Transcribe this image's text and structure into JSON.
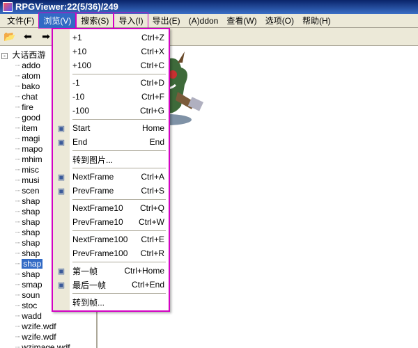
{
  "window": {
    "title": "RPGViewer:22(5/36)/249"
  },
  "menubar": {
    "file": "文件(F)",
    "browse": "浏览(V)",
    "search": "搜索(S)",
    "import": "导入(I)",
    "export": "导出(E)",
    "addon": "(A)ddon",
    "view": "查看(W)",
    "options": "选项(O)",
    "help": "帮助(H)"
  },
  "tree": {
    "root": "大话西游",
    "items": [
      "addo",
      "atom",
      "bako",
      "chat",
      "fire",
      "good",
      "item",
      "magi",
      "mapo",
      "mhim",
      "misc",
      "musi",
      "scen",
      "shap",
      "shap",
      "shap",
      "shap",
      "shap",
      "shap",
      "shap",
      "smap",
      "soun",
      "stoc",
      "wadd"
    ],
    "selected": "shap",
    "tail": [
      "wzife.wdf",
      "wzife.wdf",
      "wzimage.wdf"
    ]
  },
  "dropdown": {
    "r0": {
      "label": "+1",
      "short": "Ctrl+Z"
    },
    "r1": {
      "label": "+10",
      "short": "Ctrl+X"
    },
    "r2": {
      "label": "+100",
      "short": "Ctrl+C"
    },
    "r3": {
      "label": "-1",
      "short": "Ctrl+D"
    },
    "r4": {
      "label": "-10",
      "short": "Ctrl+F"
    },
    "r5": {
      "label": "-100",
      "short": "Ctrl+G"
    },
    "r6": {
      "label": "Start",
      "short": "Home"
    },
    "r7": {
      "label": "End",
      "short": "End"
    },
    "r8": {
      "label": "转到图片...",
      "short": ""
    },
    "r9": {
      "label": "NextFrame",
      "short": "Ctrl+A"
    },
    "r10": {
      "label": "PrevFrame",
      "short": "Ctrl+S"
    },
    "r11": {
      "label": "NextFrame10",
      "short": "Ctrl+Q"
    },
    "r12": {
      "label": "PrevFrame10",
      "short": "Ctrl+W"
    },
    "r13": {
      "label": "NextFrame100",
      "short": "Ctrl+E"
    },
    "r14": {
      "label": "PrevFrame100",
      "short": "Ctrl+R"
    },
    "r15": {
      "label": "第一帧",
      "short": "Ctrl+Home"
    },
    "r16": {
      "label": "最后一帧",
      "short": "Ctrl+End"
    },
    "r17": {
      "label": "转到帧...",
      "short": ""
    }
  }
}
